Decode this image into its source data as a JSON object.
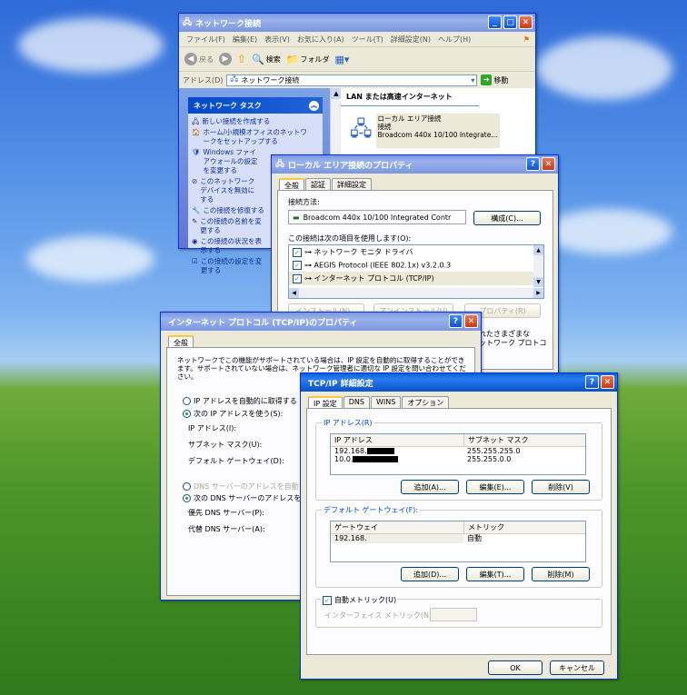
{
  "netconn": {
    "title": "ネットワーク接続",
    "menu": [
      "ファイル(F)",
      "編集(E)",
      "表示(V)",
      "お気に入り(A)",
      "ツール(T)",
      "詳細設定(N)",
      "ヘルプ(H)"
    ],
    "toolbar": {
      "back": "戻る",
      "search": "検索",
      "folders": "フォルダ"
    },
    "address_label": "アドレス(D)",
    "address_value": "ネットワーク接続",
    "go_label": "移動",
    "task_header": "ネットワーク タスク",
    "tasks": [
      "新しい接続を作成する",
      "ホーム/小規模オフィスのネットワークをセットアップする",
      "Windows ファイアウォールの設定を変更する",
      "このネットワーク デバイスを無効にする",
      "この接続を修復する",
      "この接続の名前を変更する",
      "この接続の状況を表示する",
      "この接続の設定を変更する"
    ],
    "group_header": "LAN または高速インターネット",
    "connection": {
      "name": "ローカル エリア接続",
      "status": "接続",
      "device": "Broadcom 440x 10/100 Integrate..."
    }
  },
  "lanprops": {
    "title": "ローカル エリア接続のプロパティ",
    "tabs": [
      "全般",
      "認証",
      "詳細設定"
    ],
    "connect_using_label": "接続方法:",
    "adapter": "Broadcom 440x 10/100 Integrated Contr",
    "configure_button": "構成(C)...",
    "items_label": "この接続は次の項目を使用します(O):",
    "items": [
      "ネットワーク モニタ ドライバ",
      "AEGIS Protocol (IEEE 802.1x) v3.2.0.3",
      "インターネット プロトコル (TCP/IP)"
    ],
    "install_button": "インストール(N)...",
    "uninstall_button": "アンインストール(U)",
    "properties_button": "プロパティ(R)",
    "desc_tail": "れたさまざまな\nットワーク プロトコ"
  },
  "tcpip": {
    "title": "インターネット プロトコル (TCP/IP)のプロパティ",
    "tab": "全般",
    "description": "ネットワークでこの機能がサポートされている場合は、IP 設定を自動的に取得することができます。サポートされていない場合は、ネットワーク管理者に適切な IP 設定を問い合わせてください。",
    "auto_ip": "IP アドレスを自動的に取得する",
    "manual_ip": "次の IP アドレスを使う(S):",
    "ip_label": "IP アドレス(I):",
    "subnet_label": "サブネット マスク(U):",
    "gateway_label": "デフォルト ゲートウェイ(D):",
    "auto_dns": "DNS サーバーのアドレスを自動",
    "manual_dns": "次の DNS サーバーのアドレスを",
    "preferred_dns": "優先 DNS サーバー(P):",
    "alternate_dns": "代替 DNS サーバー(A):"
  },
  "advanced": {
    "title": "TCP/IP 詳細設定",
    "tabs": [
      "IP 設定",
      "DNS",
      "WINS",
      "オプション"
    ],
    "ip_group": "IP アドレス(R)",
    "ip_headers": [
      "IP アドレス",
      "サブネット マスク"
    ],
    "ip_rows": [
      {
        "ip": "192.168.",
        "mask": "255.255.255.0"
      },
      {
        "ip": "10.0.",
        "mask": "255.255.0.0"
      }
    ],
    "add_button": "追加(A)...",
    "edit_button": "編集(E)...",
    "delete_button": "削除(V)",
    "gw_group": "デフォルト ゲートウェイ(F):",
    "gw_headers": [
      "ゲートウェイ",
      "メトリック"
    ],
    "gw_rows": [
      {
        "gw": "192.168.",
        "metric": "自動"
      }
    ],
    "gw_add_button": "追加(D)...",
    "gw_edit_button": "編集(T)...",
    "gw_delete_button": "削除(M)",
    "auto_metric": "自動メトリック(U)",
    "interface_metric": "インターフェイス メトリック(N):",
    "ok_button": "OK",
    "cancel_button": "キャンセル"
  }
}
